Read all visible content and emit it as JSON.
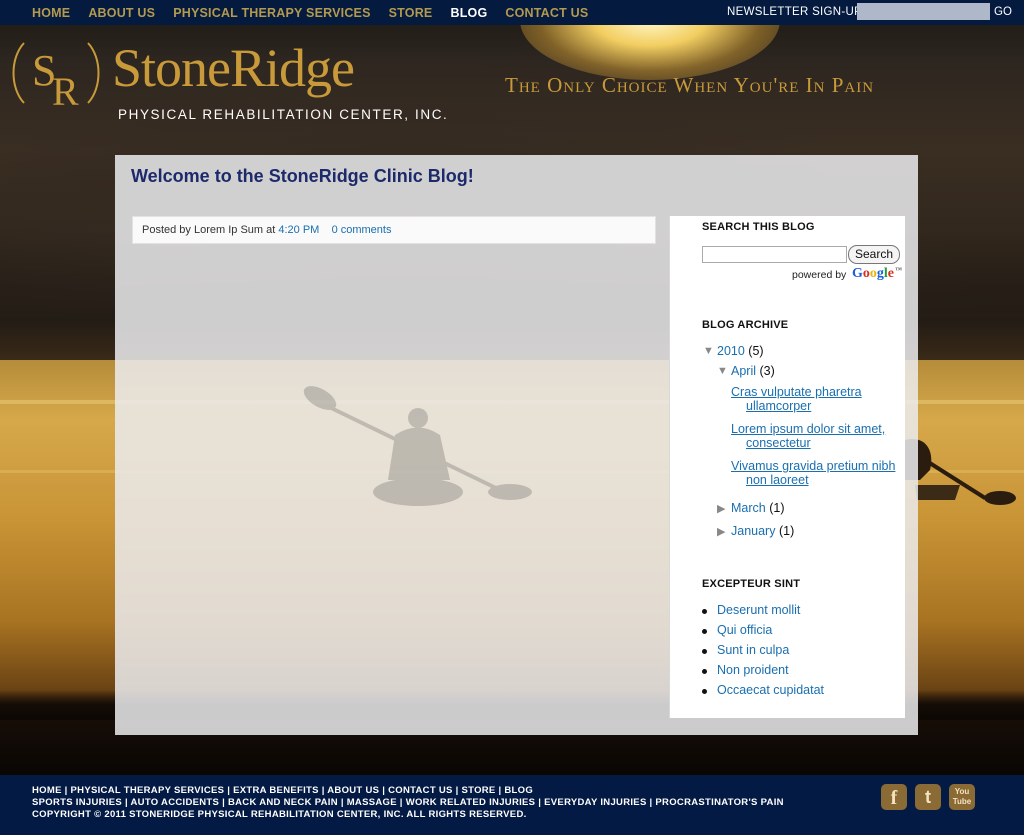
{
  "nav": {
    "items": [
      "HOME",
      "ABOUT US",
      "PHYSICAL THERAPY SERVICES",
      "STORE",
      "BLOG",
      "CONTACT US"
    ],
    "active_index": 4,
    "newsletter_label": "NEWSLETTER SIGN-UP",
    "newsletter_placeholder": "",
    "go_label": "GO"
  },
  "brand": {
    "logo_initials": "SR",
    "name_part1": "Stone",
    "name_part2": "Ridge",
    "subtitle": "PHYSICAL REHABILITATION CENTER, INC.",
    "tagline": "The Only Choice When You're In Pain",
    "accent_color": "#c99a3a"
  },
  "post": {
    "title": "Welcome to the StoneRidge Clinic Blog!",
    "posted_by_prefix": "Posted by Lorem Ip Sum at",
    "time": "4:20 PM",
    "comments": "0 comments"
  },
  "sidebar": {
    "search_heading": "SEARCH THIS BLOG",
    "search_value": "",
    "search_button": "Search",
    "powered_by": "powered by",
    "google": [
      "G",
      "o",
      "o",
      "g",
      "l",
      "e"
    ],
    "archive_heading": "BLOG ARCHIVE",
    "archive": {
      "year": "2010",
      "year_count": "(5)",
      "month_open": "April",
      "month_open_count": "(3)",
      "posts": [
        "Cras vulputate pharetra ullamcorper",
        "Lorem ipsum dolor sit amet, consectetur",
        "Vivamus gravida pretium nibh non laoreet"
      ],
      "months_closed": [
        {
          "label": "March",
          "count": "(1)"
        },
        {
          "label": "January",
          "count": "(1)"
        }
      ]
    },
    "list_heading": "EXCEPTEUR SINT",
    "list": [
      "Deserunt mollit",
      "Qui officia",
      "Sunt in culpa",
      "Non proident",
      "Occaecat cupidatat"
    ]
  },
  "footer": {
    "line1": "HOME | PHYSICAL THERAPY SERVICES | EXTRA BENEFITS | ABOUT US | CONTACT US | STORE | BLOG",
    "line2": "SPORTS INJURIES | AUTO ACCIDENTS | BACK AND NECK PAIN | MASSAGE | WORK RELATED INJURIES | EVERYDAY INJURIES | PROCRASTINATOR'S PAIN",
    "line3": "COPYRIGHT © 2011 STONERIDGE PHYSICAL REHABILITATION CENTER, INC. ALL RIGHTS RESERVED.",
    "social": [
      {
        "name": "facebook-icon",
        "glyph": "f"
      },
      {
        "name": "twitter-icon",
        "glyph": "t"
      },
      {
        "name": "youtube-icon",
        "glyph": "You Tube"
      }
    ]
  }
}
